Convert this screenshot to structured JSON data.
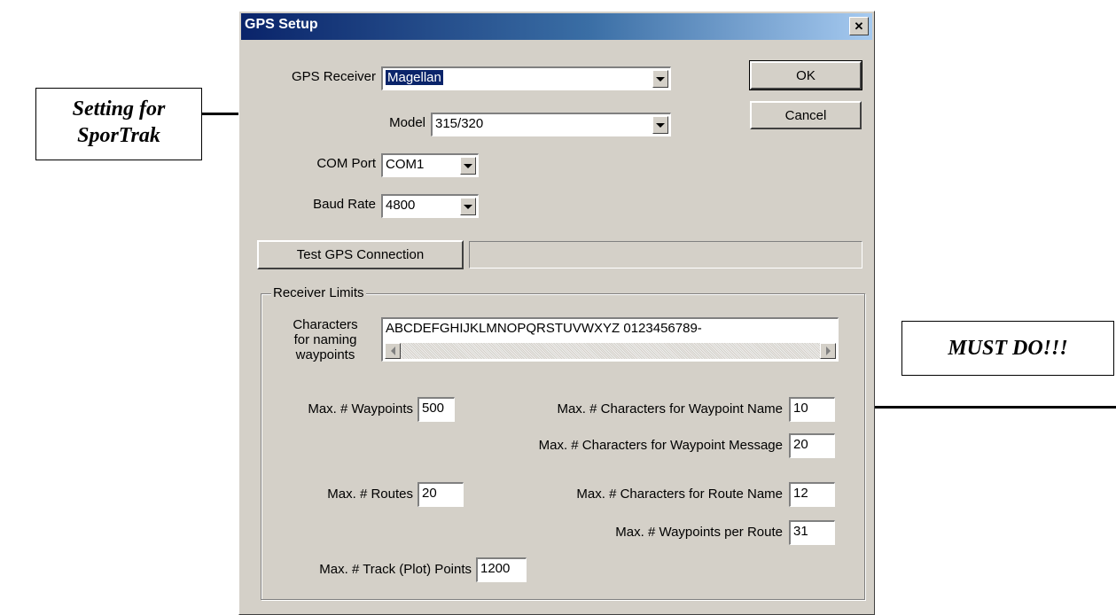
{
  "callouts": {
    "left_line1": "Setting for",
    "left_line2": "SporTrak",
    "right": "MUST DO!!!"
  },
  "dialog": {
    "title": "GPS Setup",
    "close_glyph": "✕",
    "gps_receiver": {
      "label": "GPS Receiver",
      "value": "Magellan"
    },
    "model": {
      "label": "Model",
      "value": "315/320"
    },
    "com_port": {
      "label": "COM Port",
      "value": "COM1"
    },
    "baud_rate": {
      "label": "Baud Rate",
      "value": "4800"
    },
    "ok_label": "OK",
    "cancel_label": "Cancel",
    "test_button_label": "Test GPS Connection",
    "receiver_limits": {
      "title": "Receiver Limits",
      "characters_label_1": "Characters",
      "characters_label_2": "for naming",
      "characters_label_3": "waypoints",
      "characters_value": "ABCDEFGHIJKLMNOPQRSTUVWXYZ 0123456789-",
      "max_waypoints": {
        "label": "Max. # Waypoints",
        "value": "500"
      },
      "max_chars_wp_name": {
        "label": "Max. # Characters for Waypoint Name",
        "value": "10"
      },
      "max_chars_wp_message": {
        "label": "Max. # Characters for Waypoint Message",
        "value": "20"
      },
      "max_routes": {
        "label": "Max. # Routes",
        "value": "20"
      },
      "max_chars_route_name": {
        "label": "Max. # Characters for Route Name",
        "value": "12"
      },
      "max_wp_per_route": {
        "label": "Max. # Waypoints per Route",
        "value": "31"
      },
      "max_track_points": {
        "label": "Max. # Track (Plot) Points",
        "value": "1200"
      }
    }
  },
  "colors": {
    "dialog_face": "#d4d0c8",
    "title_bar_start": "#0a246a",
    "title_bar_end": "#a6caf0",
    "selection": "#0a246a"
  }
}
